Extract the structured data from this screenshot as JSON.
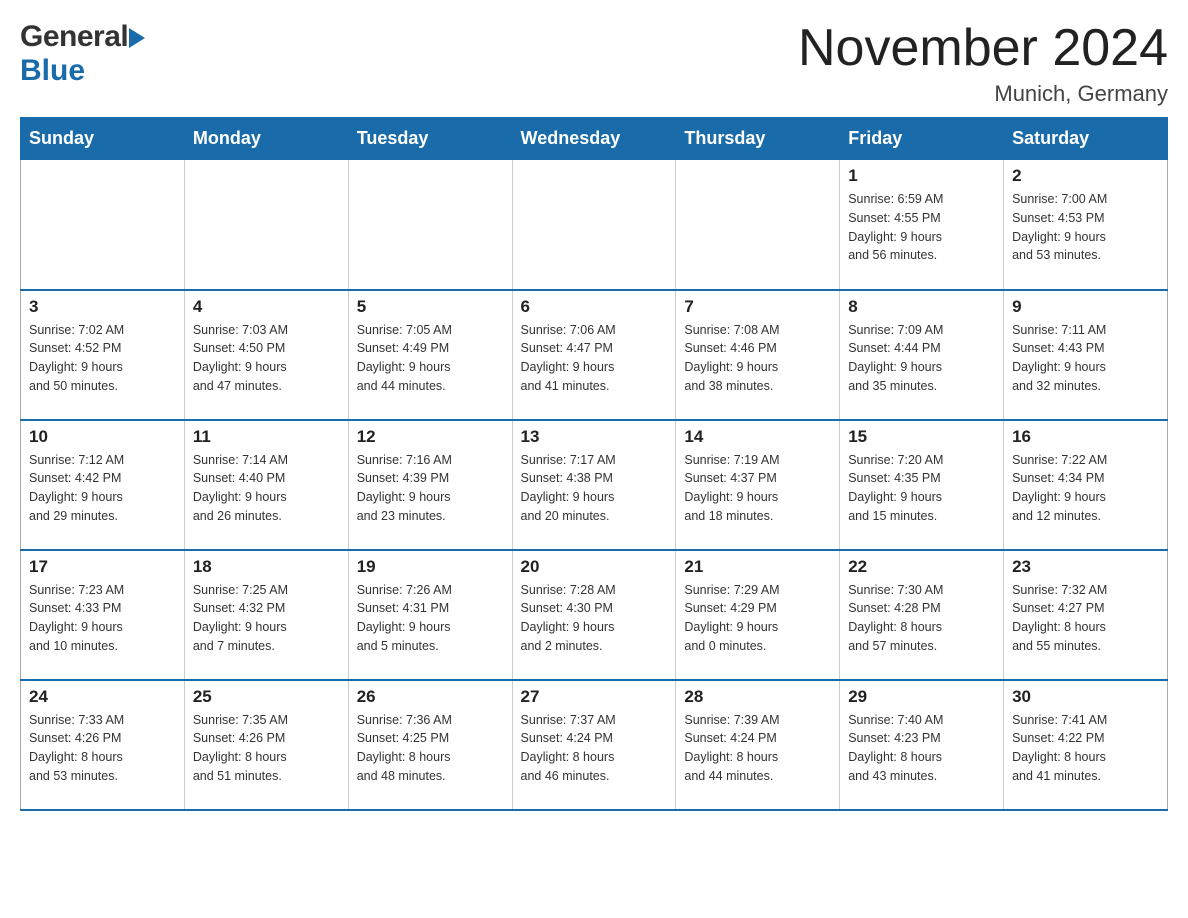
{
  "header": {
    "month_year": "November 2024",
    "location": "Munich, Germany",
    "logo_general": "General",
    "logo_blue": "Blue"
  },
  "days_of_week": [
    "Sunday",
    "Monday",
    "Tuesday",
    "Wednesday",
    "Thursday",
    "Friday",
    "Saturday"
  ],
  "weeks": [
    {
      "days": [
        {
          "number": "",
          "info": ""
        },
        {
          "number": "",
          "info": ""
        },
        {
          "number": "",
          "info": ""
        },
        {
          "number": "",
          "info": ""
        },
        {
          "number": "",
          "info": ""
        },
        {
          "number": "1",
          "info": "Sunrise: 6:59 AM\nSunset: 4:55 PM\nDaylight: 9 hours\nand 56 minutes."
        },
        {
          "number": "2",
          "info": "Sunrise: 7:00 AM\nSunset: 4:53 PM\nDaylight: 9 hours\nand 53 minutes."
        }
      ]
    },
    {
      "days": [
        {
          "number": "3",
          "info": "Sunrise: 7:02 AM\nSunset: 4:52 PM\nDaylight: 9 hours\nand 50 minutes."
        },
        {
          "number": "4",
          "info": "Sunrise: 7:03 AM\nSunset: 4:50 PM\nDaylight: 9 hours\nand 47 minutes."
        },
        {
          "number": "5",
          "info": "Sunrise: 7:05 AM\nSunset: 4:49 PM\nDaylight: 9 hours\nand 44 minutes."
        },
        {
          "number": "6",
          "info": "Sunrise: 7:06 AM\nSunset: 4:47 PM\nDaylight: 9 hours\nand 41 minutes."
        },
        {
          "number": "7",
          "info": "Sunrise: 7:08 AM\nSunset: 4:46 PM\nDaylight: 9 hours\nand 38 minutes."
        },
        {
          "number": "8",
          "info": "Sunrise: 7:09 AM\nSunset: 4:44 PM\nDaylight: 9 hours\nand 35 minutes."
        },
        {
          "number": "9",
          "info": "Sunrise: 7:11 AM\nSunset: 4:43 PM\nDaylight: 9 hours\nand 32 minutes."
        }
      ]
    },
    {
      "days": [
        {
          "number": "10",
          "info": "Sunrise: 7:12 AM\nSunset: 4:42 PM\nDaylight: 9 hours\nand 29 minutes."
        },
        {
          "number": "11",
          "info": "Sunrise: 7:14 AM\nSunset: 4:40 PM\nDaylight: 9 hours\nand 26 minutes."
        },
        {
          "number": "12",
          "info": "Sunrise: 7:16 AM\nSunset: 4:39 PM\nDaylight: 9 hours\nand 23 minutes."
        },
        {
          "number": "13",
          "info": "Sunrise: 7:17 AM\nSunset: 4:38 PM\nDaylight: 9 hours\nand 20 minutes."
        },
        {
          "number": "14",
          "info": "Sunrise: 7:19 AM\nSunset: 4:37 PM\nDaylight: 9 hours\nand 18 minutes."
        },
        {
          "number": "15",
          "info": "Sunrise: 7:20 AM\nSunset: 4:35 PM\nDaylight: 9 hours\nand 15 minutes."
        },
        {
          "number": "16",
          "info": "Sunrise: 7:22 AM\nSunset: 4:34 PM\nDaylight: 9 hours\nand 12 minutes."
        }
      ]
    },
    {
      "days": [
        {
          "number": "17",
          "info": "Sunrise: 7:23 AM\nSunset: 4:33 PM\nDaylight: 9 hours\nand 10 minutes."
        },
        {
          "number": "18",
          "info": "Sunrise: 7:25 AM\nSunset: 4:32 PM\nDaylight: 9 hours\nand 7 minutes."
        },
        {
          "number": "19",
          "info": "Sunrise: 7:26 AM\nSunset: 4:31 PM\nDaylight: 9 hours\nand 5 minutes."
        },
        {
          "number": "20",
          "info": "Sunrise: 7:28 AM\nSunset: 4:30 PM\nDaylight: 9 hours\nand 2 minutes."
        },
        {
          "number": "21",
          "info": "Sunrise: 7:29 AM\nSunset: 4:29 PM\nDaylight: 9 hours\nand 0 minutes."
        },
        {
          "number": "22",
          "info": "Sunrise: 7:30 AM\nSunset: 4:28 PM\nDaylight: 8 hours\nand 57 minutes."
        },
        {
          "number": "23",
          "info": "Sunrise: 7:32 AM\nSunset: 4:27 PM\nDaylight: 8 hours\nand 55 minutes."
        }
      ]
    },
    {
      "days": [
        {
          "number": "24",
          "info": "Sunrise: 7:33 AM\nSunset: 4:26 PM\nDaylight: 8 hours\nand 53 minutes."
        },
        {
          "number": "25",
          "info": "Sunrise: 7:35 AM\nSunset: 4:26 PM\nDaylight: 8 hours\nand 51 minutes."
        },
        {
          "number": "26",
          "info": "Sunrise: 7:36 AM\nSunset: 4:25 PM\nDaylight: 8 hours\nand 48 minutes."
        },
        {
          "number": "27",
          "info": "Sunrise: 7:37 AM\nSunset: 4:24 PM\nDaylight: 8 hours\nand 46 minutes."
        },
        {
          "number": "28",
          "info": "Sunrise: 7:39 AM\nSunset: 4:24 PM\nDaylight: 8 hours\nand 44 minutes."
        },
        {
          "number": "29",
          "info": "Sunrise: 7:40 AM\nSunset: 4:23 PM\nDaylight: 8 hours\nand 43 minutes."
        },
        {
          "number": "30",
          "info": "Sunrise: 7:41 AM\nSunset: 4:22 PM\nDaylight: 8 hours\nand 41 minutes."
        }
      ]
    }
  ]
}
